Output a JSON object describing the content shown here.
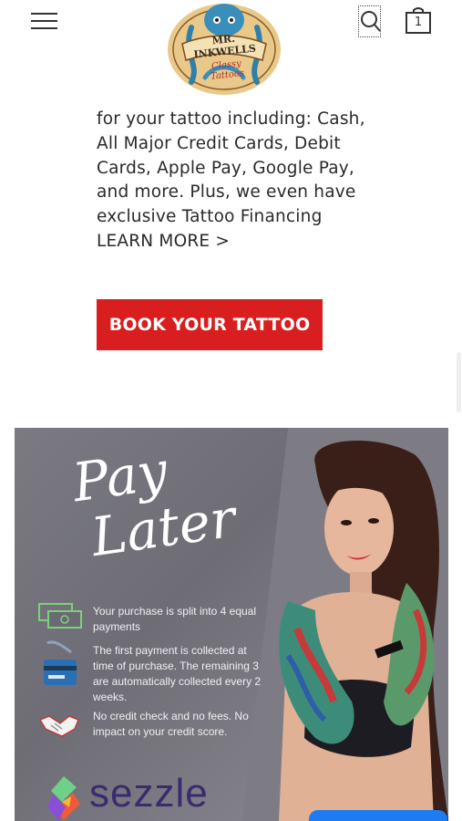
{
  "header": {
    "menu_icon": "hamburger-icon",
    "logo": {
      "line1": "MR. INKWELLS",
      "line2": "Classy Tattoos"
    },
    "search_icon": "search-icon",
    "cart_icon": "shopping-bag-icon",
    "cart_count": "1"
  },
  "content": {
    "lines": [
      "for your tattoo including: Cash,",
      "All Major Credit Cards, Debit",
      "Cards, Apple Pay, Google Pay,",
      "and more. Plus, we even have",
      "exclusive Tattoo Financing"
    ],
    "learn_more": "LEARN MORE >"
  },
  "cta": {
    "label": "BOOK YOUR TATTOO",
    "color": "#d81e1e"
  },
  "banner": {
    "headline_1": "Pay",
    "headline_2": "Later",
    "features": [
      {
        "icon": "money-icon",
        "text": "Your purchase is split into 4 equal payments"
      },
      {
        "icon": "credit-card-hand-icon",
        "text": "The first payment is collected at time of purchase. The remaining 3 are automatically collected every 2 weeks."
      },
      {
        "icon": "handshake-icon",
        "text": "No credit check and no fees. No impact on your credit score."
      }
    ],
    "brand": "sezzle"
  },
  "colors": {
    "accent_red": "#d81e1e",
    "sezzle_purple": "#3c2a6e",
    "chat_blue": "#1e7bf2"
  }
}
